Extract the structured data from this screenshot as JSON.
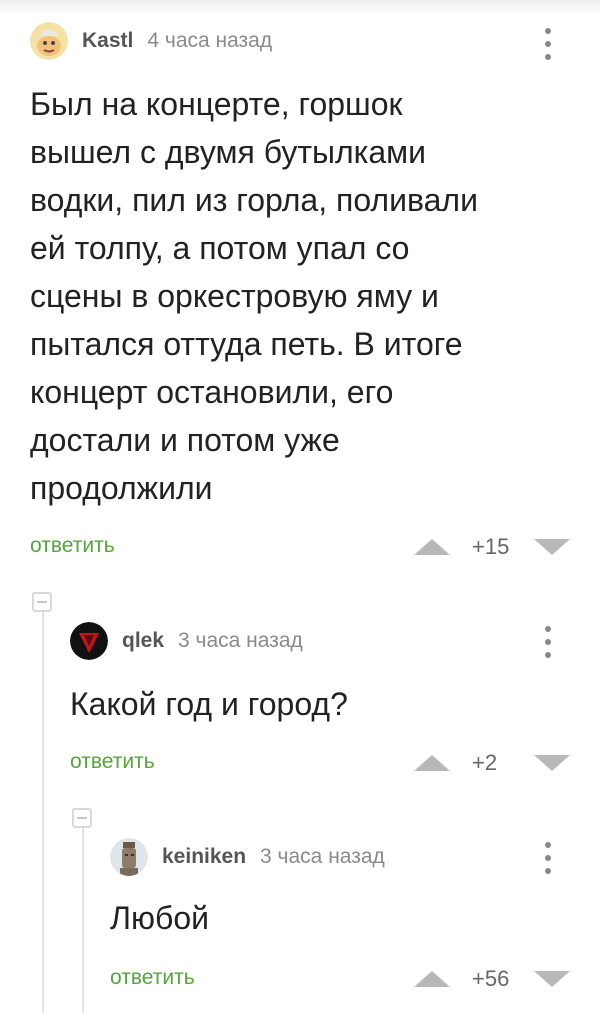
{
  "comments": [
    {
      "author": "Kastl",
      "time": "4 часа назад",
      "avatar_icon": "cartoon-face-avatar",
      "text_lines": [
        "Был на концерте, горшок",
        "вышел с двумя бутылками",
        "водки, пил из горла, поливали",
        "ей толпу, а потом упал со",
        "сцены в оркестровую яму и",
        "пытался оттуда петь. В итоге",
        "концерт остановили, его",
        "достали и потом уже",
        "продолжили"
      ],
      "reply_label": "ответить",
      "score": "+15"
    },
    {
      "author": "qlek",
      "time": "3 часа назад",
      "avatar_icon": "red-emblem-avatar",
      "text_lines": [
        "Какой год и город?"
      ],
      "reply_label": "ответить",
      "score": "+2"
    },
    {
      "author": "keiniken",
      "time": "3 часа назад",
      "avatar_icon": "statue-head-avatar",
      "text_lines": [
        "Любой"
      ],
      "reply_label": "ответить",
      "score": "+56"
    }
  ],
  "colors": {
    "reply": "#5aa33c",
    "author": "#555555",
    "time": "#8a8a8a",
    "vote_arrow": "#b8b8b8"
  }
}
